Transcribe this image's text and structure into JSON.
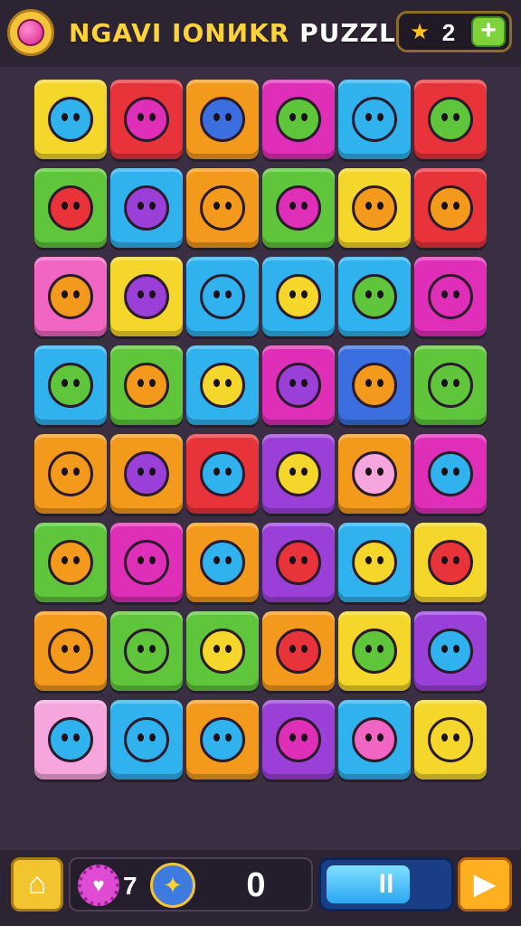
{
  "header": {
    "title_part1": "NGAVI IONИKR",
    "title_part2": " PUZZLE",
    "coin_icon": "star-gem-icon",
    "coin_count": "2",
    "plus_label": "+",
    "colors": {
      "accent": "#ffd23a",
      "coin": "#ffc21d",
      "plus": "#7ed23a"
    }
  },
  "board": {
    "rows": 8,
    "cols": 6,
    "palette": {
      "yellow": "#f4d72a",
      "red": "#e8333a",
      "orange": "#f39a1c",
      "magenta": "#df2fb8",
      "cyan": "#2fb2ee",
      "green": "#5fc53a",
      "pink": "#f066c2",
      "purple": "#9a3fd8",
      "blue": "#3b6fe0",
      "lightpink": "#f6a6dc"
    },
    "tiles": [
      [
        "yellow",
        "red",
        "orange",
        "magenta",
        "cyan",
        "red"
      ],
      [
        "green",
        "cyan",
        "orange",
        "green",
        "yellow",
        "red"
      ],
      [
        "pink",
        "yellow",
        "cyan",
        "cyan",
        "cyan",
        "magenta"
      ],
      [
        "cyan",
        "green",
        "cyan",
        "magenta",
        "blue",
        "green"
      ],
      [
        "orange",
        "orange",
        "red",
        "purple",
        "orange",
        "magenta"
      ],
      [
        "green",
        "magenta",
        "orange",
        "purple",
        "cyan",
        "yellow"
      ],
      [
        "orange",
        "green",
        "green",
        "orange",
        "yellow",
        "purple"
      ],
      [
        "lightpink",
        "cyan",
        "orange",
        "purple",
        "cyan",
        "yellow"
      ]
    ]
  },
  "footer": {
    "home_icon": "home-icon",
    "lives_icon": "heart-gear-icon",
    "lives_count": "7",
    "bird_icon": "bird-icon",
    "score": "0",
    "progress": {
      "label": "II",
      "fill_fraction": 0.67
    },
    "play_icon": "play-icon",
    "colors": {
      "progress": "#2aa6f2",
      "home": "#f2c530",
      "play": "#ffb020"
    }
  }
}
